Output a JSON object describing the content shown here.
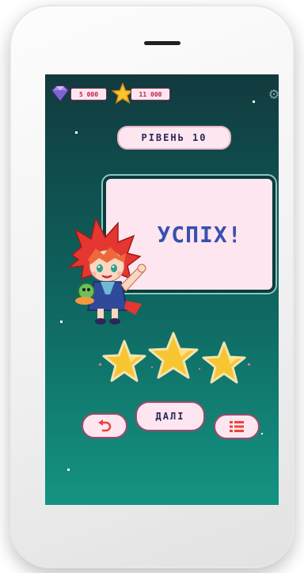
{
  "hud": {
    "gems": "5 000",
    "stars": "11 000",
    "gem_icon": "diamond-icon",
    "star_icon": "star-icon",
    "settings_icon": "gear-icon"
  },
  "level_label": "РІВЕНЬ 10",
  "result_text": "УСПІХ!",
  "stars_earned": 3,
  "stars_total": 3,
  "buttons": {
    "next_label": "ДАЛІ",
    "replay_icon": "replay-icon",
    "menu_icon": "menu-list-icon"
  },
  "colors": {
    "accent_pink": "#fde6ef",
    "border_maroon": "#a04868",
    "text_navy": "#2a2858",
    "star_gold": "#f7c531",
    "screen_top": "#123a3e",
    "screen_bottom": "#149482"
  }
}
